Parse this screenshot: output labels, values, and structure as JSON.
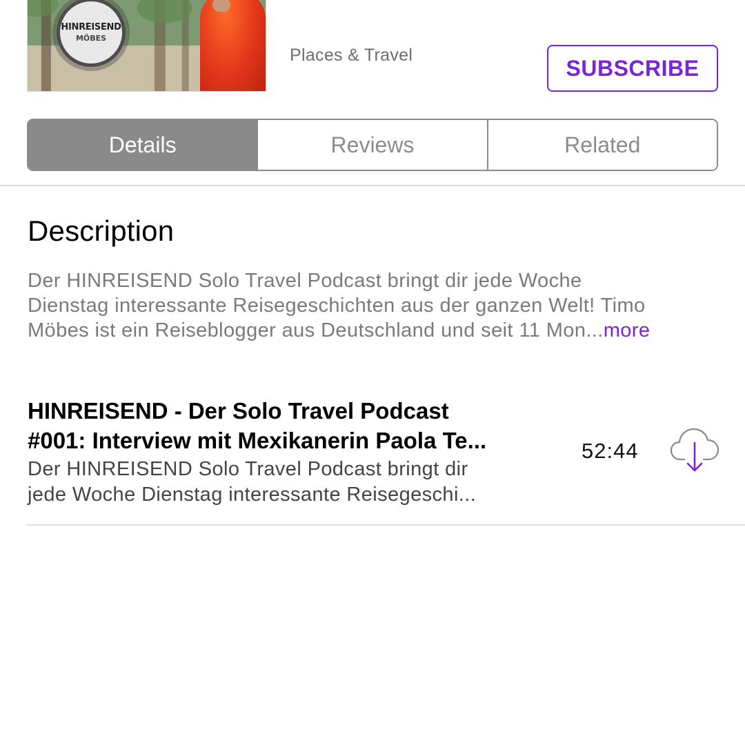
{
  "header": {
    "artwork_logo_line1": "HINREISEND",
    "artwork_logo_line2": "MÖBES",
    "category": "Places & Travel",
    "subscribe_label": "SUBSCRIBE"
  },
  "tabs": [
    {
      "label": "Details",
      "active": true
    },
    {
      "label": "Reviews",
      "active": false
    },
    {
      "label": "Related",
      "active": false
    }
  ],
  "description": {
    "title": "Description",
    "lines": [
      "Der HINREISEND Solo Travel Podcast bringt dir jede Woche",
      "Dienstag interessante Reisegeschichten aus der ganzen Welt! Timo",
      "Möbes ist ein Reiseblogger aus Deutschland und seit 11 Mon..."
    ],
    "more_label": "more"
  },
  "episode": {
    "title_lines": [
      "HINREISEND - Der Solo Travel Podcast",
      "#001: Interview mit Mexikanerin Paola Te..."
    ],
    "desc_lines": [
      "Der HINREISEND Solo Travel Podcast bringt dir",
      "jede Woche Dienstag interessante Reisegeschi..."
    ],
    "duration": "52:44",
    "download_icon": "cloud-download-icon"
  },
  "colors": {
    "accent": "#7b23d8",
    "segment_active": "#8a8a8a",
    "secondary_text": "#7a7a7a"
  }
}
